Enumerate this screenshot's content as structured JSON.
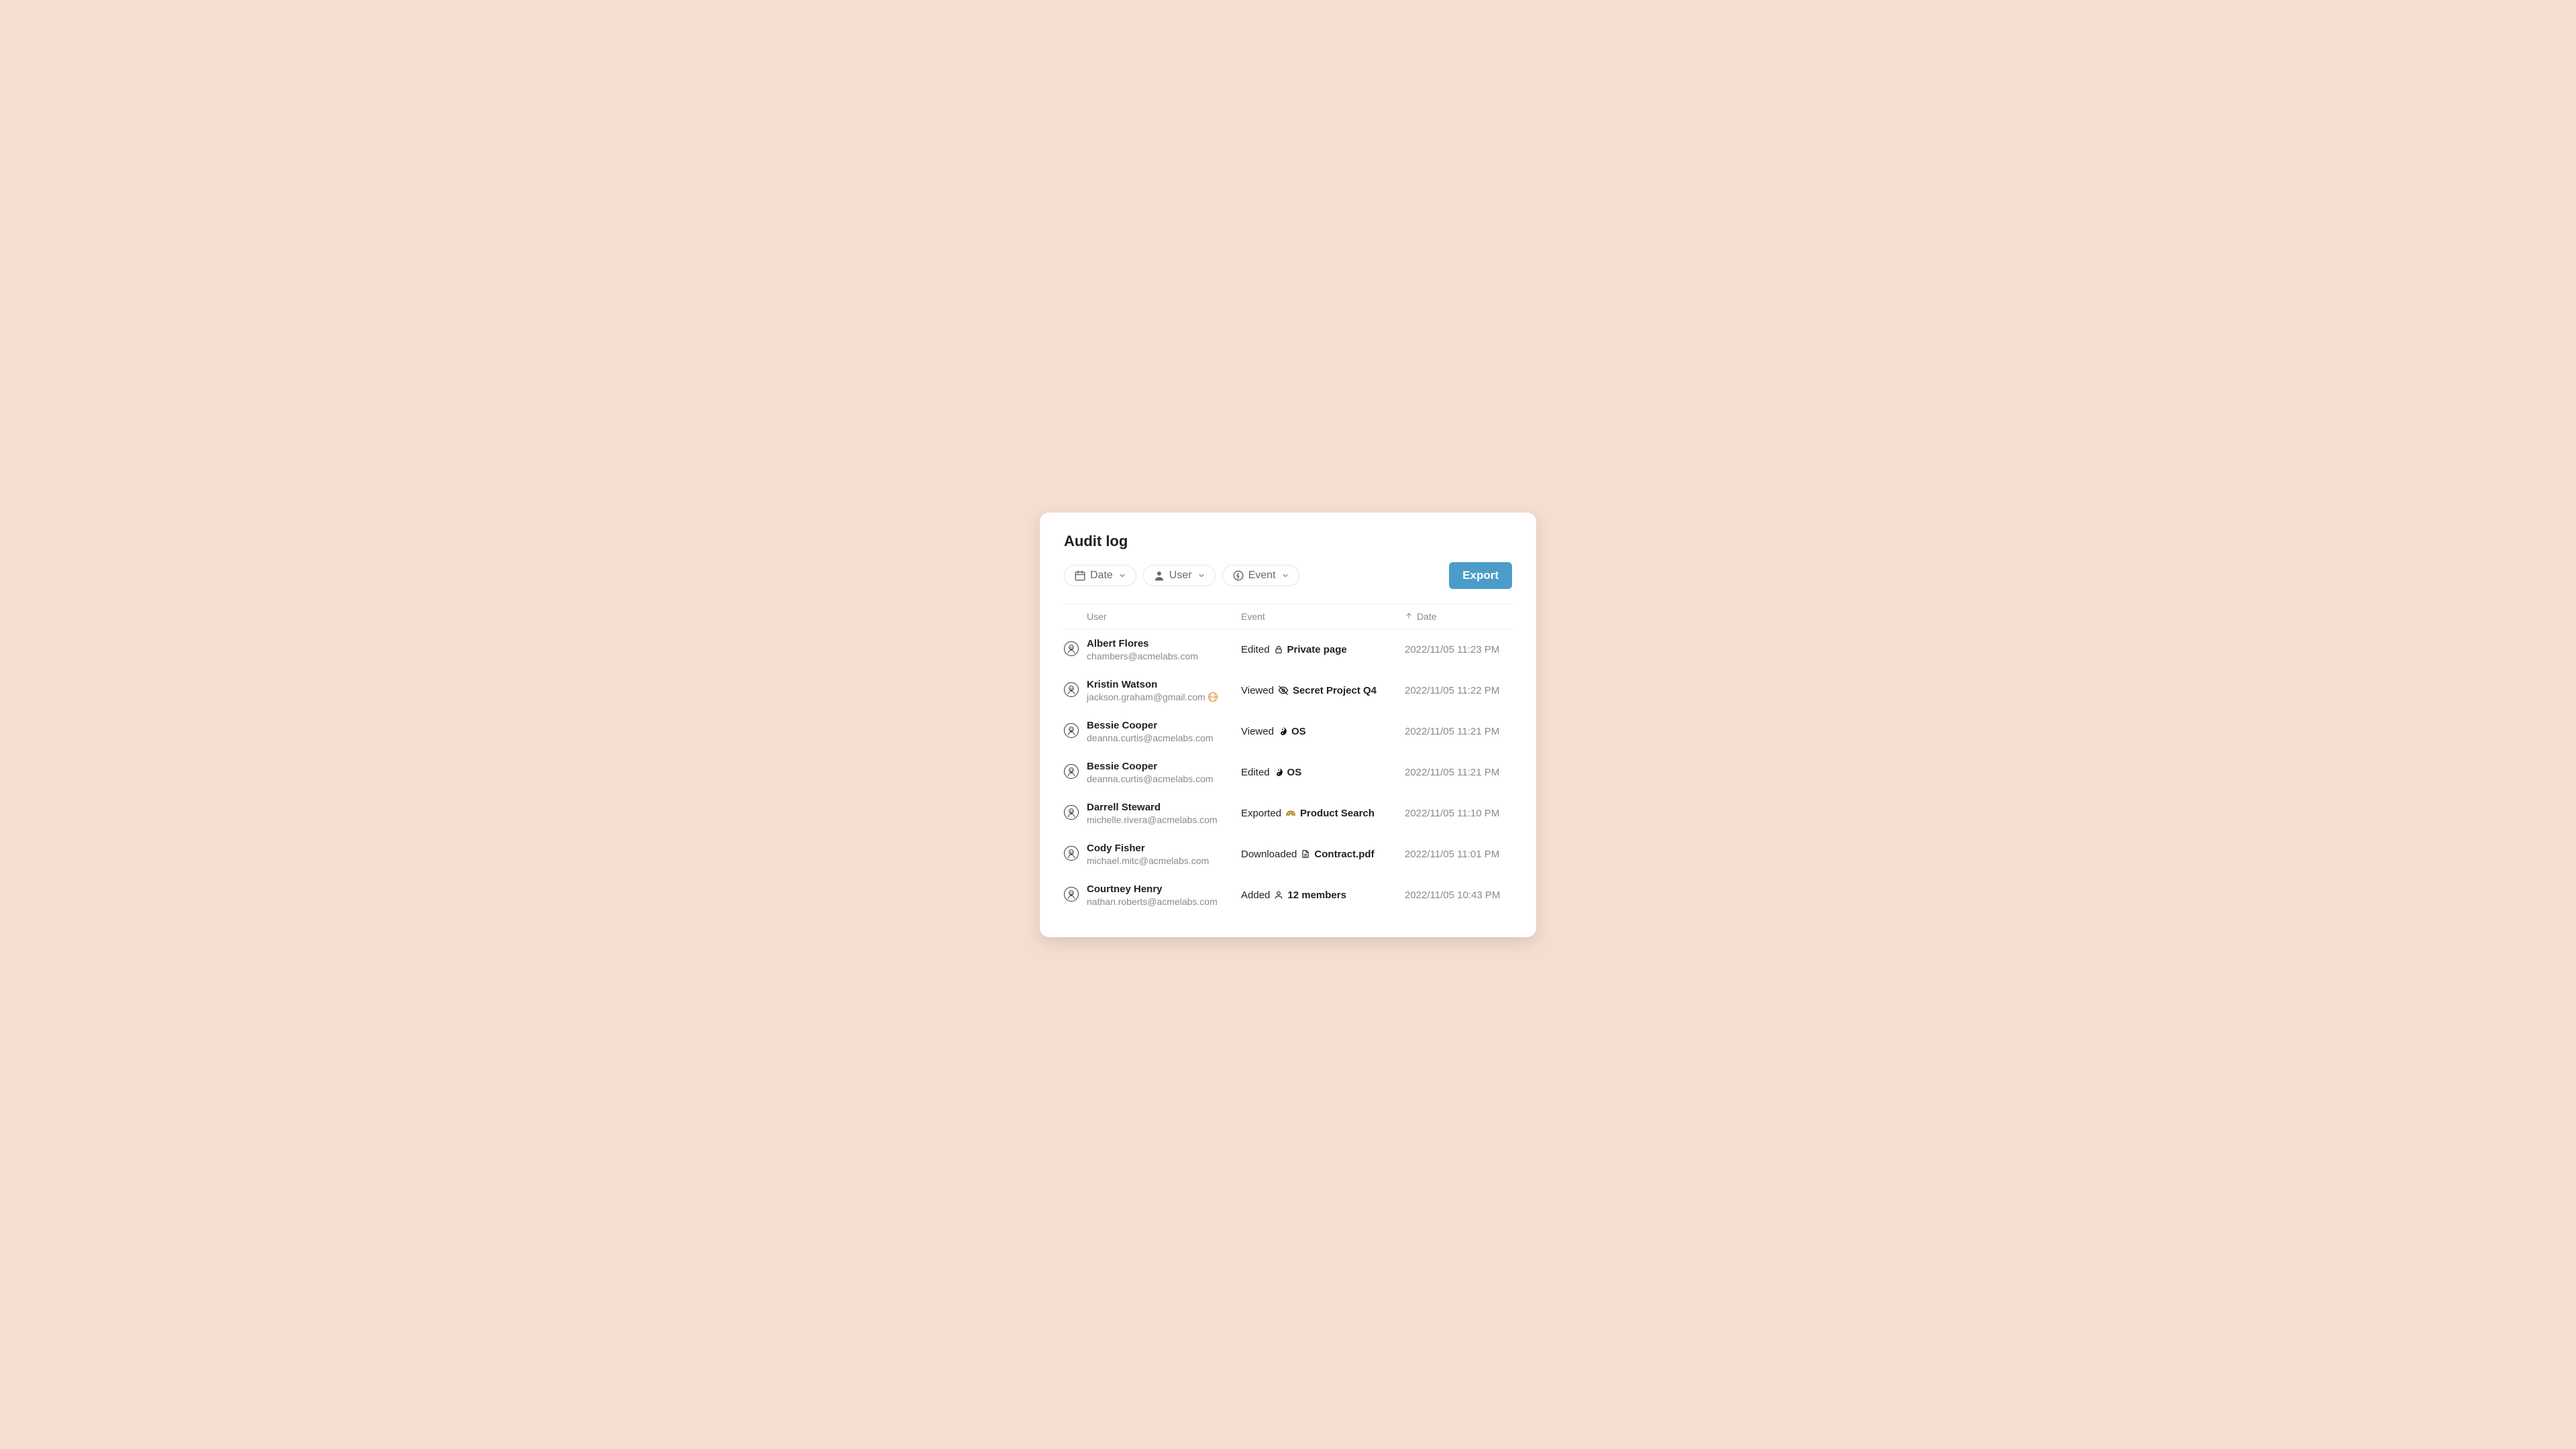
{
  "title": "Audit log",
  "filters": {
    "date_label": "Date",
    "user_label": "User",
    "event_label": "Event"
  },
  "export_label": "Export",
  "columns": {
    "user": "User",
    "event": "Event",
    "date": "Date"
  },
  "rows": [
    {
      "name": "Albert Flores",
      "email": "chambers@acmelabs.com",
      "email_external": false,
      "action": "Edited",
      "target_icon": "lock",
      "target": "Private page",
      "date": "2022/11/05 11:23 PM"
    },
    {
      "name": "Kristin Watson",
      "email": "jackson.graham@gmail.com",
      "email_external": true,
      "action": "Viewed",
      "target_icon": "eye-off",
      "target": "Secret Project Q4",
      "date": "2022/11/05 11:22 PM"
    },
    {
      "name": "Bessie Cooper",
      "email": "deanna.curtis@acmelabs.com",
      "email_external": false,
      "action": "Viewed",
      "target_icon": "yinyang",
      "target": "OS",
      "date": "2022/11/05 11:21 PM"
    },
    {
      "name": "Bessie Cooper",
      "email": "deanna.curtis@acmelabs.com",
      "email_external": false,
      "action": "Edited",
      "target_icon": "yinyang",
      "target": "OS",
      "date": "2022/11/05 11:21 PM"
    },
    {
      "name": "Darrell Steward",
      "email": "michelle.rivera@acmelabs.com",
      "email_external": false,
      "action": "Exported",
      "target_icon": "rainbow",
      "target": "Product Search",
      "date": "2022/11/05 11:10 PM"
    },
    {
      "name": "Cody Fisher",
      "email": "michael.mitc@acmelabs.com",
      "email_external": false,
      "action": "Downloaded",
      "target_icon": "file",
      "target": "Contract.pdf",
      "date": "2022/11/05 11:01 PM"
    },
    {
      "name": "Courtney Henry",
      "email": "nathan.roberts@acmelabs.com",
      "email_external": false,
      "action": "Added",
      "target_icon": "person",
      "target": "12 members",
      "date": "2022/11/05 10:43 PM"
    }
  ]
}
